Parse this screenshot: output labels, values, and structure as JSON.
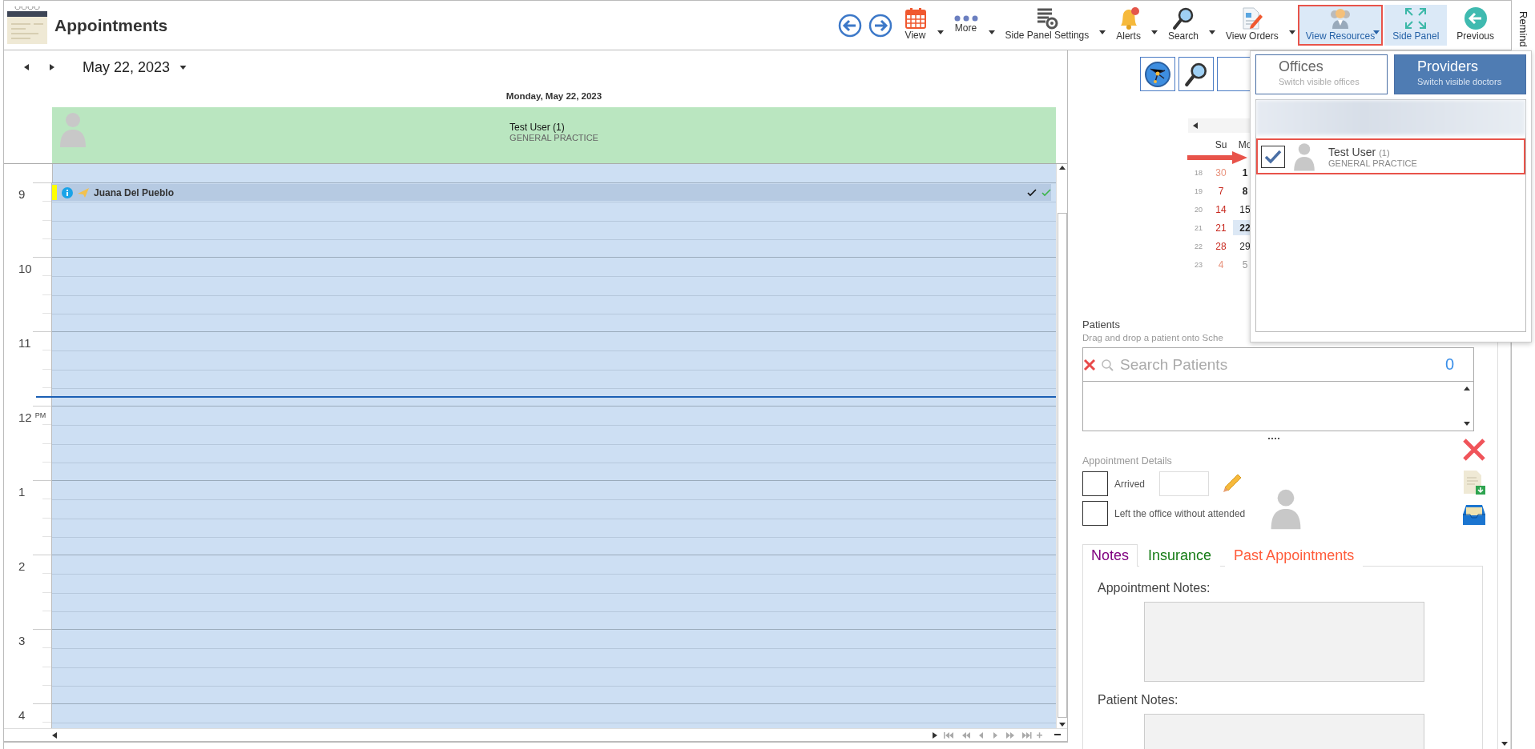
{
  "app": {
    "title": "Appointments"
  },
  "toolbar": {
    "buttons": [
      {
        "label": "View",
        "has_menu": true,
        "selected": false,
        "outlined": false
      },
      {
        "label": "More",
        "has_menu": true,
        "selected": false,
        "outlined": false
      },
      {
        "label": "Side Panel Settings",
        "has_menu": true,
        "selected": false,
        "outlined": false
      },
      {
        "label": "Alerts",
        "has_menu": true,
        "selected": false,
        "outlined": false
      },
      {
        "label": "Search",
        "has_menu": true,
        "selected": false,
        "outlined": false
      },
      {
        "label": "View Orders",
        "has_menu": true,
        "selected": false,
        "outlined": false
      },
      {
        "label": "View Resources",
        "has_menu": true,
        "selected": true,
        "outlined": true
      },
      {
        "label": "Side Panel",
        "has_menu": false,
        "selected": true,
        "outlined": false
      },
      {
        "label": "Previous",
        "has_menu": false,
        "selected": false,
        "outlined": false
      }
    ]
  },
  "remind_tab": "Remind",
  "scheduler": {
    "date": "May 22, 2023",
    "day_header": "Monday, May 22, 2023",
    "resource": {
      "name": "Test User (1)",
      "specialty": "GENERAL PRACTICE"
    },
    "hours": [
      {
        "label": "9",
        "appointments": [
          {
            "name": "Juana Del Pueblo"
          }
        ]
      },
      {
        "label": "10"
      },
      {
        "label": "11"
      },
      {
        "label": "12",
        "suffix": "PM"
      },
      {
        "label": "1"
      },
      {
        "label": "2"
      },
      {
        "label": "3"
      },
      {
        "label": "4"
      }
    ]
  },
  "mini_calendar": {
    "weekdays": [
      "Su",
      "Mo"
    ],
    "weeks": [
      {
        "number": "18",
        "days": [
          {
            "label": "30",
            "other_month": true,
            "bold": false,
            "selected": false
          },
          {
            "label": "1",
            "other_month": false,
            "bold": true,
            "selected": false
          }
        ]
      },
      {
        "number": "19",
        "days": [
          {
            "label": "7",
            "other_month": false,
            "bold": false,
            "selected": false
          },
          {
            "label": "8",
            "other_month": false,
            "bold": true,
            "selected": false
          }
        ]
      },
      {
        "number": "20",
        "days": [
          {
            "label": "14",
            "other_month": false,
            "bold": false,
            "selected": false
          },
          {
            "label": "15",
            "other_month": false,
            "bold": false,
            "selected": false
          }
        ]
      },
      {
        "number": "21",
        "days": [
          {
            "label": "21",
            "other_month": false,
            "bold": false,
            "selected": false
          },
          {
            "label": "22",
            "other_month": false,
            "bold": true,
            "selected": true
          }
        ]
      },
      {
        "number": "22",
        "days": [
          {
            "label": "28",
            "other_month": false,
            "bold": false,
            "selected": false
          },
          {
            "label": "29",
            "other_month": false,
            "bold": false,
            "selected": false
          }
        ]
      },
      {
        "number": "23",
        "days": [
          {
            "label": "4",
            "other_month": true,
            "bold": false,
            "selected": false
          },
          {
            "label": "5",
            "other_month": true,
            "bold": false,
            "selected": false
          }
        ]
      }
    ]
  },
  "patients": {
    "title": "Patients",
    "hint": "Drag and drop a patient onto Sche",
    "search_placeholder": "Search Patients",
    "count": "0"
  },
  "appointment_details": {
    "title": "Appointment Details",
    "checks": [
      {
        "label": "Arrived",
        "checked": false
      },
      {
        "label": "Left the office without attended",
        "checked": false
      }
    ]
  },
  "detail_tabs": [
    {
      "label": "Notes",
      "selected": true,
      "color": "#800080"
    },
    {
      "label": "Insurance",
      "selected": false,
      "color": "#137a13"
    },
    {
      "label": "Past Appointments",
      "selected": false,
      "color": "#ff5b3a"
    }
  ],
  "notes_fields": [
    "Appointment Notes:",
    "Patient Notes:"
  ],
  "resources_dropdown": {
    "tabs": [
      {
        "label": "Offices",
        "hint": "Switch visible offices",
        "selected": false
      },
      {
        "label": "Providers",
        "hint": "Switch visible doctors",
        "selected": true
      }
    ],
    "providers": [
      {
        "name": "Test User",
        "count": "(1)",
        "specialty": "GENERAL PRACTICE",
        "checked": true
      }
    ]
  }
}
